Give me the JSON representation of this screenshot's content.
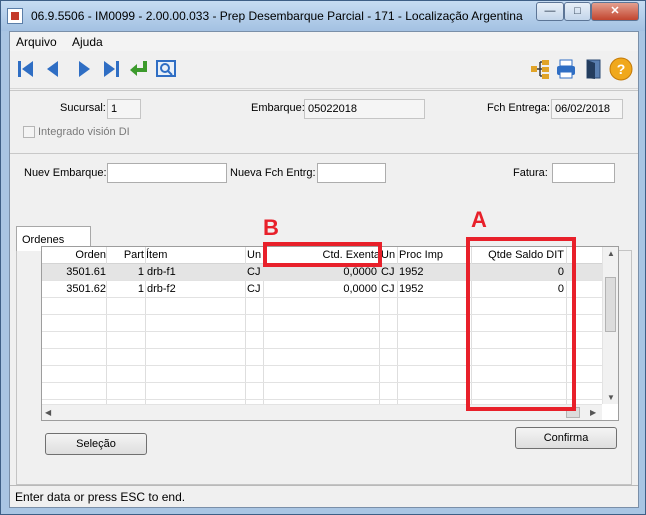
{
  "window": {
    "title": "06.9.5506 - IM0099 - 2.00.00.033 - Prep Desembarque Parcial - 171 - Localização Argentina",
    "controls": {
      "minimize": "—",
      "maximize": "□",
      "close": "✕"
    }
  },
  "menu": {
    "items": [
      "Arquivo",
      "Ajuda"
    ]
  },
  "toolbar": {
    "icons": [
      "first-record-icon",
      "previous-record-icon",
      "next-record-icon",
      "last-record-icon",
      "goto-icon",
      "search-icon",
      "hierarchy-icon",
      "print-icon",
      "exit-icon",
      "help-icon"
    ],
    "help_glyph": "?"
  },
  "header": {
    "sucursal_label": "Sucursal:",
    "sucursal_value": "1",
    "embarque_label": "Embarque:",
    "embarque_value": "05022018",
    "fch_entrega_label": "Fch Entrega:",
    "fch_entrega_value": "06/02/2018",
    "integrado_label": "Integrado visión DI"
  },
  "filters": {
    "nuev_embarque_label": "Nuev Embarque:",
    "nuev_embarque_value": "",
    "nueva_fch_label": "Nueva Fch Entrg:",
    "nueva_fch_value": "",
    "fatura_label": "Fatura:",
    "fatura_value": ""
  },
  "tabs": [
    {
      "label": "Ordenes"
    }
  ],
  "grid": {
    "columns": [
      "Orden",
      "Part",
      "Ítem",
      "Un",
      "Ctd. Exenta",
      "Un",
      "Proc Imp",
      "Qtde Saldo DIT"
    ],
    "rows": [
      {
        "orden": "3501.61",
        "part": "1",
        "item": "drb-f1",
        "un": "CJ",
        "ctd_exenta": "0,0000",
        "un2": "CJ",
        "proc_imp": "1952",
        "qtde_saldo": "0"
      },
      {
        "orden": "3501.62",
        "part": "1",
        "item": "drb-f2",
        "un": "CJ",
        "ctd_exenta": "0,0000",
        "un2": "CJ",
        "proc_imp": "1952",
        "qtde_saldo": "0"
      }
    ]
  },
  "buttons": {
    "selecao_label": "Seleção",
    "confirma_label": "Confirma"
  },
  "status": {
    "text": "Enter data or press ESC to end."
  },
  "annotations": {
    "a_label": "A",
    "b_label": "B",
    "color": "#e8202a"
  }
}
